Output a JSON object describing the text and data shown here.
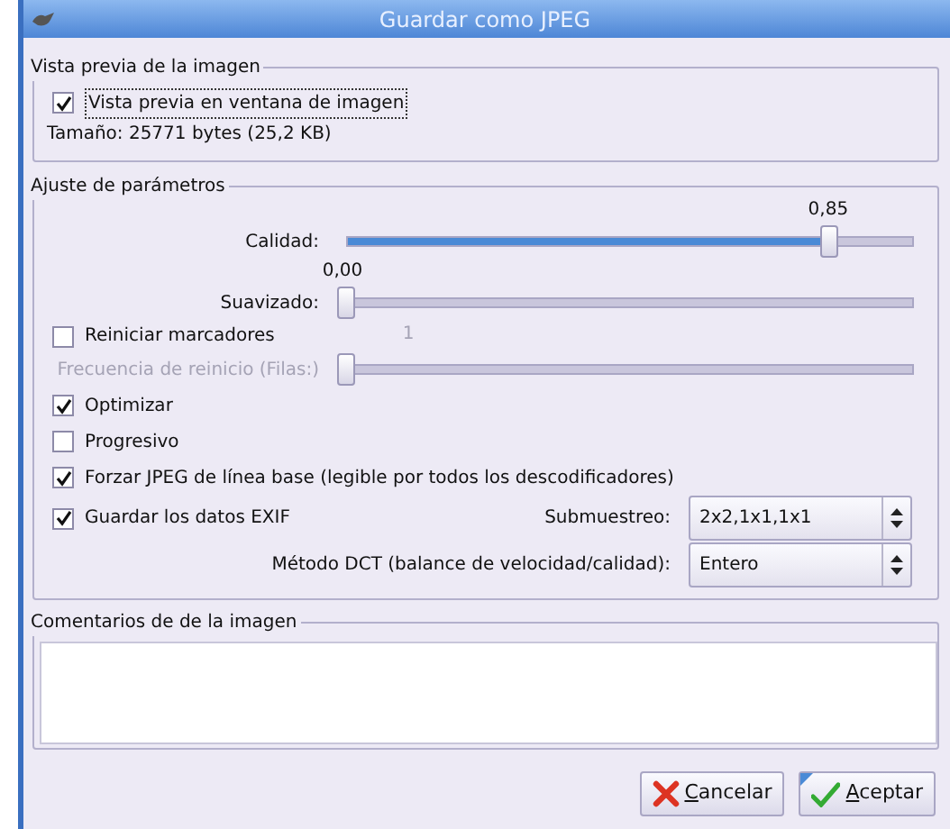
{
  "window": {
    "title": "Guardar como JPEG"
  },
  "preview": {
    "title": "Vista previa de la imagen",
    "checkbox": {
      "label": "Vista previa en ventana de imagen",
      "checked": true,
      "focused": true
    },
    "size": "Tamaño: 25771 bytes (25,2 KB)"
  },
  "params": {
    "title": "Ajuste de parámetros",
    "rows": [
      {
        "kind": "slider",
        "label": "Calidad:",
        "reading": "0,85",
        "level": 0.85,
        "disabled": false
      },
      {
        "kind": "slider",
        "label": "Suavizado:",
        "reading": "0,00",
        "level": 0,
        "disabled": false
      },
      {
        "kind": "check",
        "label": "Reiniciar marcadores",
        "checked": false,
        "reading": "1"
      },
      {
        "kind": "slider",
        "label": "Frecuencia de reinicio (Filas:)",
        "level": 0,
        "disabled": true
      },
      {
        "kind": "check",
        "label": "Optimizar",
        "checked": true
      },
      {
        "kind": "check",
        "label": "Progresivo",
        "checked": false
      },
      {
        "kind": "check",
        "label": "Forzar JPEG de línea base (legible por todos los descodificadores)",
        "checked": true
      },
      {
        "kind": "check",
        "label": "Guardar los datos EXIF",
        "checked": true,
        "combo": {
          "label": "Submuestreo:",
          "value": "2x2,1x1,1x1"
        }
      },
      {
        "kind": "combo",
        "label": "Método DCT (balance de velocidad/calidad):",
        "value": "Entero"
      }
    ]
  },
  "comments": {
    "title": "Comentarios de de la imagen"
  },
  "buttons": [
    {
      "kind": "cancel",
      "label": "Cancelar",
      "mnemonic": true,
      "default": false
    },
    {
      "kind": "ok",
      "label": "Aceptar",
      "mnemonic": true,
      "default": true
    }
  ]
}
